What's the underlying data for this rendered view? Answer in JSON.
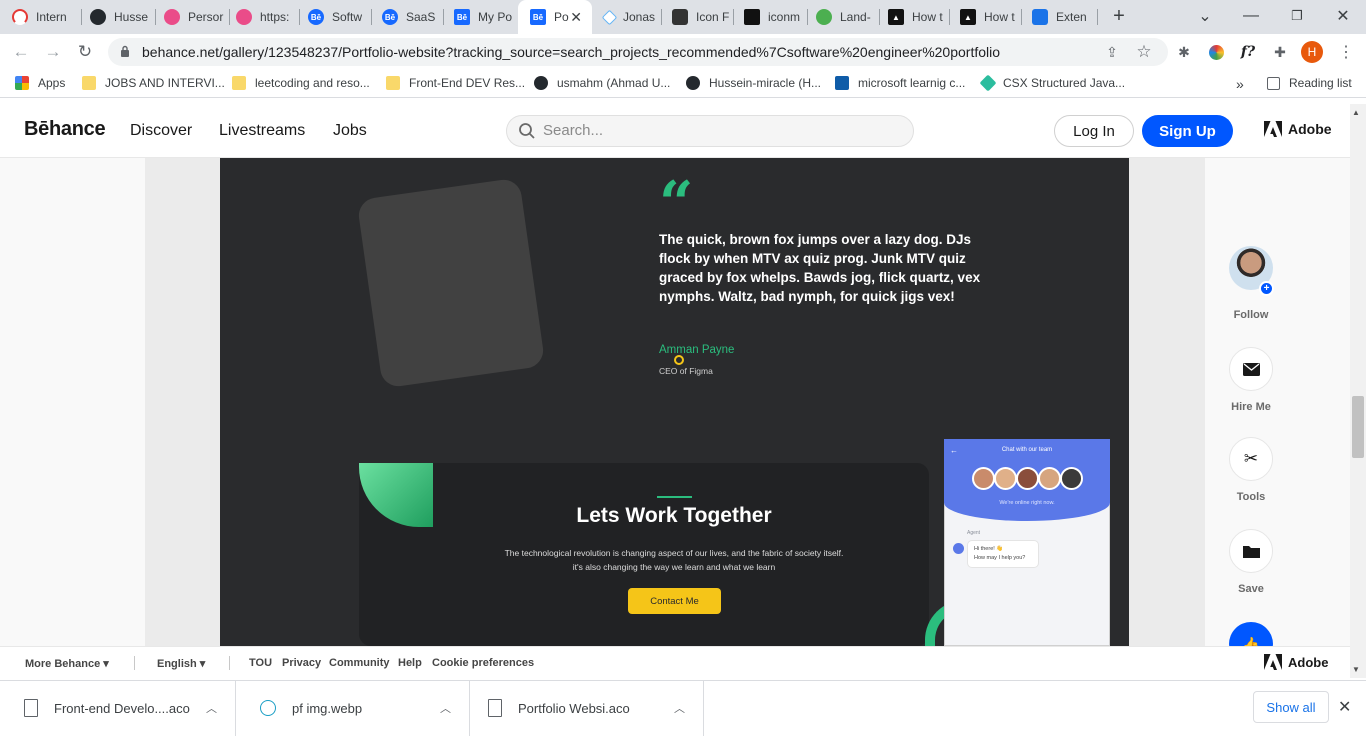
{
  "browser": {
    "tabs": [
      {
        "label": "Intern",
        "icon": "speed-icon"
      },
      {
        "label": "Husse",
        "icon": "github-icon"
      },
      {
        "label": "Persor",
        "icon": "dribbble-icon"
      },
      {
        "label": "https:",
        "icon": "dribbble-icon"
      },
      {
        "label": "Softw",
        "icon": "behance-icon"
      },
      {
        "label": "SaaS",
        "icon": "behance-icon"
      },
      {
        "label": "My Po",
        "icon": "behance-icon"
      },
      {
        "label": "Po",
        "icon": "behance-icon",
        "active": true
      },
      {
        "label": "Jonas",
        "icon": "diamond-icon"
      },
      {
        "label": "Icon F",
        "icon": "iconify-icon"
      },
      {
        "label": "iconm",
        "icon": "iconmonstr-icon"
      },
      {
        "label": "Land-",
        "icon": "globe-icon"
      },
      {
        "label": "How t",
        "icon": "nextjs-icon"
      },
      {
        "label": "How t",
        "icon": "nextjs-icon"
      },
      {
        "label": "Exten",
        "icon": "puzzle-icon"
      }
    ],
    "new_tab": "+",
    "address": "behance.net/gallery/123548237/Portfolio-website?tracking_source=search_projects_recommended%7Csoftware%20engineer%20portfolio",
    "profile_initial": "H",
    "bookmarks": [
      {
        "label": "Apps",
        "icon": "apps-grid-icon"
      },
      {
        "label": "JOBS AND INTERVI...",
        "icon": "folder-icon"
      },
      {
        "label": "leetcoding and reso...",
        "icon": "folder-icon"
      },
      {
        "label": "Front-End DEV Res...",
        "icon": "folder-icon"
      },
      {
        "label": "usmahm (Ahmad U...",
        "icon": "github-icon"
      },
      {
        "label": "Hussein-miracle (H...",
        "icon": "github-icon"
      },
      {
        "label": "microsoft learnig c...",
        "icon": "play-icon"
      },
      {
        "label": "CSX Structured Java...",
        "icon": "csx-icon"
      }
    ],
    "bookmarks_more": "»",
    "reading_list": "Reading list"
  },
  "behance": {
    "logo": "Bēhance",
    "nav": [
      "Discover",
      "Livestreams",
      "Jobs"
    ],
    "search_placeholder": "Search...",
    "login": "Log In",
    "signup": "Sign Up",
    "adobe": "Adobe"
  },
  "project": {
    "quote_mark": "“",
    "quote": "The quick, brown fox jumps over a lazy dog. DJs flock by when MTV ax quiz prog. Junk MTV quiz graced by fox whelps. Bawds jog, flick quartz, vex nymphs. Waltz, bad nymph, for quick jigs vex!",
    "author": "Amman Payne",
    "role": "CEO of Figma",
    "lets_title": "Lets Work Together",
    "lets_text": "The technological revolution is changing aspect of our lives, and the fabric of society itself. it's also changing the way we learn and what we learn",
    "contact_button": "Contact Me",
    "chat": {
      "title": "Chat with our team",
      "subtitle": "We're online right now.",
      "agent_label": "Agent",
      "bubble_line1": "Hi there! 👋",
      "bubble_line2": "How may I help you?"
    }
  },
  "sidebar": {
    "follow": "Follow",
    "hire": "Hire Me",
    "tools": "Tools",
    "save": "Save"
  },
  "footer": {
    "more": "More Behance ▾",
    "language": "English ▾",
    "links": [
      "TOU",
      "Privacy",
      "Community",
      "Help",
      "Cookie preferences"
    ],
    "adobe": "Adobe"
  },
  "downloads": {
    "items": [
      "Front-end Develo....aco",
      "pf img.webp",
      "Portfolio Websi.aco"
    ],
    "show_all": "Show all"
  }
}
